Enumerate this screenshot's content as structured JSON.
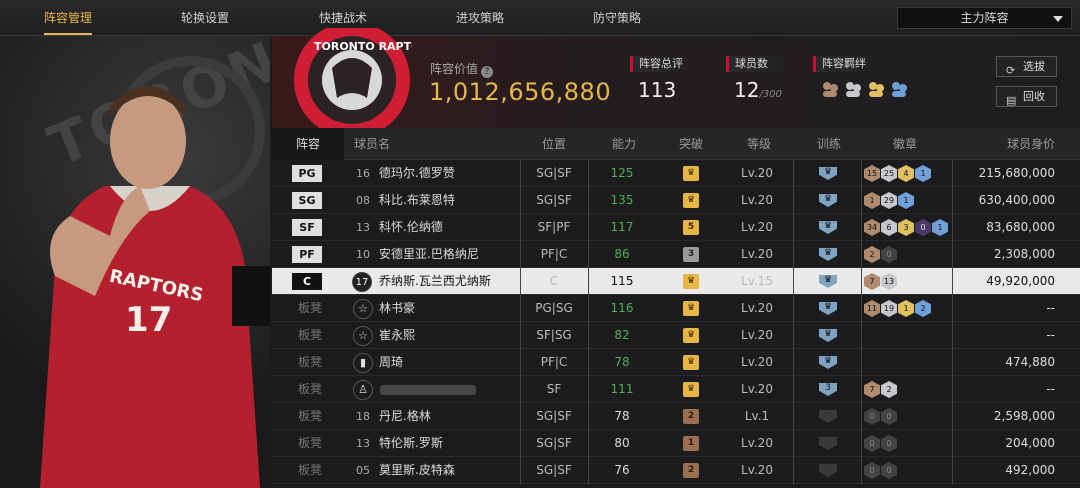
{
  "tabs": [
    "阵容管理",
    "轮换设置",
    "快捷战术",
    "进攻策略",
    "防守策略"
  ],
  "lineup_dropdown": "主力阵容",
  "left_panel": {
    "bg_text": "TORONTO",
    "jersey_team": "RAPTORS",
    "jersey_number": "17"
  },
  "header": {
    "logo_text": "TORONTO RAPTORS",
    "value_label": "阵容价值",
    "value": "1,012,656,880",
    "overall_label": "阵容总评",
    "overall": "113",
    "players_label": "球员数",
    "players": "12",
    "players_max": "/300",
    "bond_label": "阵容羁绊",
    "btn_select": "选拔",
    "btn_back": "回收"
  },
  "columns": [
    "阵容",
    "球员名",
    "位置",
    "能力",
    "突破",
    "等级",
    "训练",
    "徽章",
    "球员身价"
  ],
  "rows": [
    {
      "slot": "PG",
      "starter": true,
      "jersey": "16",
      "name": "德玛尔.德罗赞",
      "pos": "SG|SF",
      "rating": "125",
      "green": true,
      "bt": "gold",
      "bt_text": "♛",
      "level": "Lv.20",
      "train": "♛",
      "badges": [
        [
          "b",
          "15"
        ],
        [
          "s",
          "25"
        ],
        [
          "g",
          "4"
        ],
        [
          "bl",
          "1"
        ]
      ],
      "salary": "215,680,000"
    },
    {
      "slot": "SG",
      "starter": true,
      "jersey": "08",
      "name": "科比.布莱恩特",
      "pos": "SG|SF",
      "rating": "135",
      "green": true,
      "bt": "gold",
      "bt_text": "♛",
      "level": "Lv.20",
      "train": "♛",
      "badges": [
        [
          "b",
          "1"
        ],
        [
          "s",
          "29"
        ],
        [
          "bl",
          "1"
        ]
      ],
      "salary": "630,400,000"
    },
    {
      "slot": "SF",
      "starter": true,
      "jersey": "13",
      "name": "科怀.伦纳德",
      "pos": "SF|PF",
      "rating": "117",
      "green": true,
      "bt": "gold",
      "bt_text": "5",
      "level": "Lv.20",
      "train": "♛",
      "badges": [
        [
          "b",
          "34"
        ],
        [
          "s",
          "6"
        ],
        [
          "g",
          "3"
        ],
        [
          "pu",
          "0"
        ],
        [
          "bl",
          "1"
        ]
      ],
      "salary": "83,680,000"
    },
    {
      "slot": "PF",
      "starter": true,
      "jersey": "10",
      "name": "安德里亚.巴格纳尼",
      "pos": "PF|C",
      "rating": "86",
      "green": true,
      "bt": "gray",
      "bt_text": "3",
      "level": "Lv.20",
      "train": "♛",
      "badges": [
        [
          "b",
          "2"
        ],
        [
          "d",
          "0"
        ]
      ],
      "salary": "2,308,000"
    },
    {
      "slot": "C",
      "starter": true,
      "selected": true,
      "jersey": "17",
      "name": "乔纳斯.瓦兰西尤纳斯",
      "pos": "C",
      "rating": "115",
      "green": false,
      "bt": "gold",
      "bt_text": "♛",
      "level": "Lv.15",
      "train": "♛",
      "badges": [
        [
          "b",
          "7"
        ],
        [
          "s",
          "13"
        ]
      ],
      "salary": "49,920,000"
    },
    {
      "slot": "板凳",
      "jersey": "☆",
      "name": "林书豪",
      "pos": "PG|SG",
      "rating": "116",
      "green": true,
      "bt": "gold",
      "bt_text": "♛",
      "level": "Lv.20",
      "train": "♛",
      "badges": [
        [
          "b",
          "11"
        ],
        [
          "s",
          "19"
        ],
        [
          "g",
          "1"
        ],
        [
          "bl",
          "2"
        ]
      ],
      "salary": "--"
    },
    {
      "slot": "板凳",
      "jersey": "☆",
      "name": "崔永熙",
      "pos": "SF|SG",
      "rating": "82",
      "green": true,
      "bt": "gold",
      "bt_text": "♛",
      "level": "Lv.20",
      "train": "♛",
      "badges": [],
      "salary": "--"
    },
    {
      "slot": "板凳",
      "jersey": "▮",
      "name": "周琦",
      "pos": "PF|C",
      "rating": "78",
      "green": true,
      "bt": "gold",
      "bt_text": "♛",
      "level": "Lv.20",
      "train": "♛",
      "badges": [],
      "salary": "474,880"
    },
    {
      "slot": "板凳",
      "jersey": "♙",
      "name": "",
      "blur": true,
      "pos": "SF",
      "rating": "111",
      "green": true,
      "bt": "gold",
      "bt_text": "♛",
      "level": "Lv.20",
      "train": "3",
      "badges": [
        [
          "b",
          "7"
        ],
        [
          "s",
          "2"
        ]
      ],
      "salary": "--"
    },
    {
      "slot": "板凳",
      "jersey": "18",
      "name": "丹尼.格林",
      "pos": "SG|SF",
      "rating": "78",
      "green": false,
      "bt": "bronze",
      "bt_text": "2",
      "level": "Lv.1",
      "train": "",
      "badges": [
        [
          "d",
          "0"
        ],
        [
          "d",
          "0"
        ]
      ],
      "salary": "2,598,000"
    },
    {
      "slot": "板凳",
      "jersey": "13",
      "name": "特伦斯.罗斯",
      "pos": "SG|SF",
      "rating": "80",
      "green": false,
      "bt": "bronze",
      "bt_text": "1",
      "level": "Lv.20",
      "train": "",
      "badges": [
        [
          "d",
          "0"
        ],
        [
          "d",
          "0"
        ]
      ],
      "salary": "204,000"
    },
    {
      "slot": "板凳",
      "jersey": "05",
      "name": "莫里斯.皮特森",
      "pos": "SG|SF",
      "rating": "76",
      "green": false,
      "bt": "bronze",
      "bt_text": "2",
      "level": "Lv.20",
      "train": "",
      "badges": [
        [
          "d",
          "0"
        ],
        [
          "d",
          "0"
        ]
      ],
      "salary": "492,000"
    }
  ]
}
